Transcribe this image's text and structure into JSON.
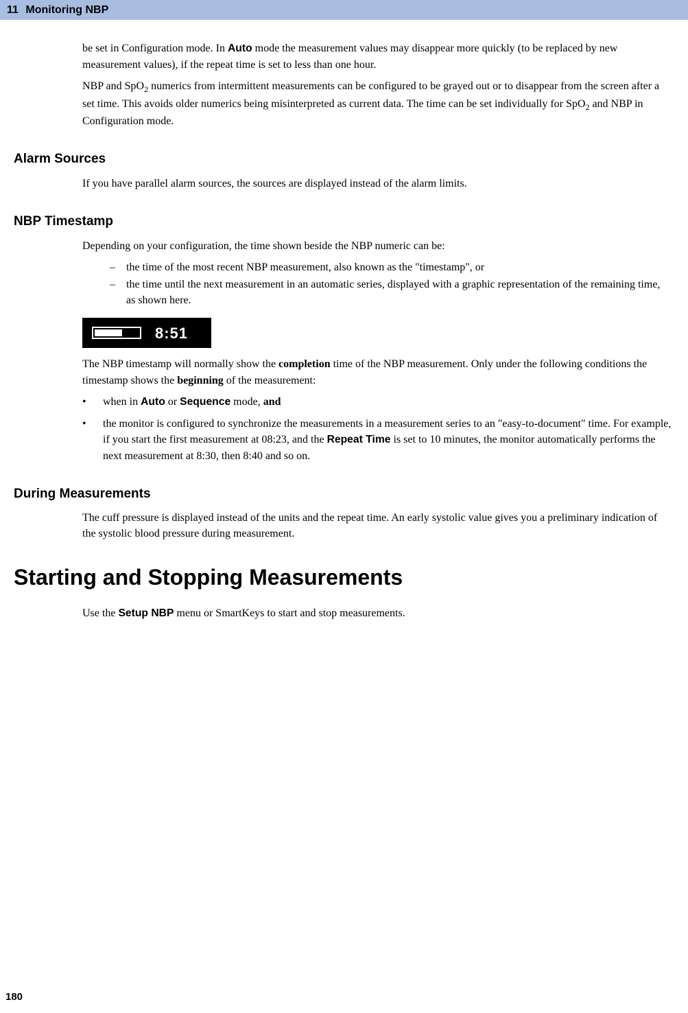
{
  "header": {
    "chapter_num": "11",
    "chapter_title": "Monitoring NBP"
  },
  "intro": {
    "p1_a": "be set in Configuration mode. In ",
    "p1_auto": "Auto",
    "p1_b": " mode the measurement values may disappear more quickly (to be replaced by new measurement values), if the repeat time is set to less than one hour.",
    "p2_a": "NBP and SpO",
    "p2_sub1": "2",
    "p2_b": " numerics from intermittent measurements can be configured to be grayed out or to disappear from the screen after a set time. This avoids older numerics being misinterpreted as current data. The time can be set individually for SpO",
    "p2_sub2": "2",
    "p2_c": " and NBP in Configuration mode."
  },
  "alarm": {
    "heading": "Alarm Sources",
    "body": "If you have parallel alarm sources, the sources are displayed instead of the alarm limits."
  },
  "timestamp": {
    "heading": "NBP Timestamp",
    "intro": "Depending on your configuration, the time shown beside the NBP numeric can be:",
    "item1": "the time of the most recent NBP measurement, also known as the \"timestamp\", or",
    "item2": "the time until the next measurement in an automatic series, displayed with a graphic representation of the remaining time, as shown here.",
    "time_display": "8:51",
    "after_a": "The NBP timestamp will normally show the ",
    "after_completion": "completion",
    "after_b": " time of the NBP measurement. Only under the following conditions the timestamp shows the ",
    "after_beginning": "beginning",
    "after_c": " of the measurement:",
    "b1_a": "when in ",
    "b1_auto": "Auto",
    "b1_b": " or ",
    "b1_seq": "Sequence",
    "b1_c": " mode, ",
    "b1_and": "and",
    "b2_a": "the monitor is configured to synchronize the measurements in a measurement series to an \"easy-to-document\" time. For example, if you start the first measurement at 08:23, and the ",
    "b2_repeat": "Repeat Time",
    "b2_b": " is set to 10 minutes, the monitor automatically performs the next measurement at 8:30, then 8:40 and so on."
  },
  "during": {
    "heading": "During Measurements",
    "body": "The cuff pressure is displayed instead of the units and the repeat time. An early systolic value gives you a preliminary indication of the systolic blood pressure during measurement."
  },
  "startstop": {
    "heading": "Starting and Stopping Measurements",
    "body_a": "Use the ",
    "body_setup": "Setup NBP",
    "body_b": " menu or SmartKeys to start and stop measurements."
  },
  "page_number": "180"
}
